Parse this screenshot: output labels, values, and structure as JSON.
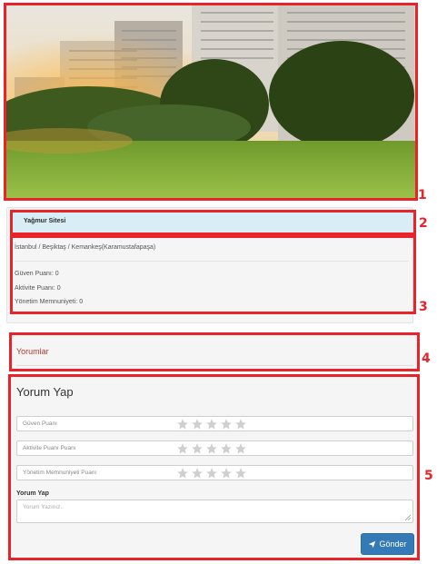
{
  "property": {
    "name": "Yağmur Sitesi",
    "location": "İstanbul / Beşiktaş / Kemankeş(Karamustafapaşa)",
    "stats": [
      {
        "label": "Güven Puanı: 0"
      },
      {
        "label": "Aktivite Puanı: 0"
      },
      {
        "label": "Yönetim Memnuniyeti: 0"
      }
    ]
  },
  "comments": {
    "title": "Yorumlar"
  },
  "review_form": {
    "title": "Yorum Yap",
    "ratings": [
      {
        "placeholder": "Güven Puanı",
        "stars": 0,
        "max": 5
      },
      {
        "placeholder": "Aktivite Puanı Puanı",
        "stars": 0,
        "max": 5
      },
      {
        "placeholder": "Yönetim Memnuniyeti Puanı",
        "stars": 0,
        "max": 5
      }
    ],
    "comment_label": "Yorum Yap",
    "comment_placeholder": "Yorum Yazınız..",
    "submit_label": "Gönder",
    "submit_icon": "paper-plane-icon"
  },
  "annotations": [
    "1",
    "2",
    "3",
    "4",
    "5"
  ],
  "colors": {
    "highlight": "#e8232a",
    "primary": "#337ab7",
    "title_bar": "#d9edf7",
    "comments_title": "#b03a2e"
  }
}
